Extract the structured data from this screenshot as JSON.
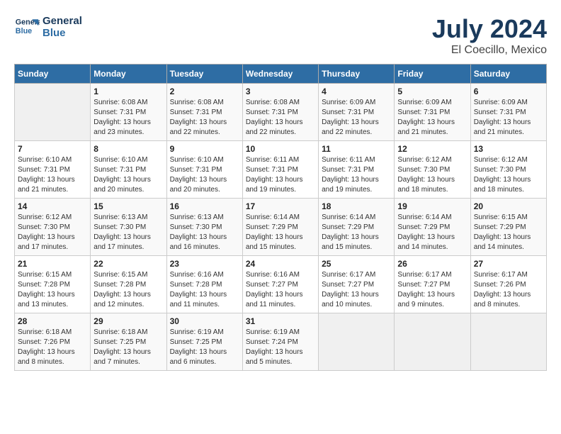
{
  "header": {
    "logo_line1": "General",
    "logo_line2": "Blue",
    "month_year": "July 2024",
    "location": "El Coecillo, Mexico"
  },
  "days_of_week": [
    "Sunday",
    "Monday",
    "Tuesday",
    "Wednesday",
    "Thursday",
    "Friday",
    "Saturday"
  ],
  "weeks": [
    [
      {
        "day": "",
        "info": ""
      },
      {
        "day": "1",
        "info": "Sunrise: 6:08 AM\nSunset: 7:31 PM\nDaylight: 13 hours\nand 23 minutes."
      },
      {
        "day": "2",
        "info": "Sunrise: 6:08 AM\nSunset: 7:31 PM\nDaylight: 13 hours\nand 22 minutes."
      },
      {
        "day": "3",
        "info": "Sunrise: 6:08 AM\nSunset: 7:31 PM\nDaylight: 13 hours\nand 22 minutes."
      },
      {
        "day": "4",
        "info": "Sunrise: 6:09 AM\nSunset: 7:31 PM\nDaylight: 13 hours\nand 22 minutes."
      },
      {
        "day": "5",
        "info": "Sunrise: 6:09 AM\nSunset: 7:31 PM\nDaylight: 13 hours\nand 21 minutes."
      },
      {
        "day": "6",
        "info": "Sunrise: 6:09 AM\nSunset: 7:31 PM\nDaylight: 13 hours\nand 21 minutes."
      }
    ],
    [
      {
        "day": "7",
        "info": ""
      },
      {
        "day": "8",
        "info": "Sunrise: 6:10 AM\nSunset: 7:31 PM\nDaylight: 13 hours\nand 20 minutes."
      },
      {
        "day": "9",
        "info": "Sunrise: 6:10 AM\nSunset: 7:31 PM\nDaylight: 13 hours\nand 20 minutes."
      },
      {
        "day": "10",
        "info": "Sunrise: 6:11 AM\nSunset: 7:31 PM\nDaylight: 13 hours\nand 19 minutes."
      },
      {
        "day": "11",
        "info": "Sunrise: 6:11 AM\nSunset: 7:31 PM\nDaylight: 13 hours\nand 19 minutes."
      },
      {
        "day": "12",
        "info": "Sunrise: 6:12 AM\nSunset: 7:30 PM\nDaylight: 13 hours\nand 18 minutes."
      },
      {
        "day": "13",
        "info": "Sunrise: 6:12 AM\nSunset: 7:30 PM\nDaylight: 13 hours\nand 18 minutes."
      }
    ],
    [
      {
        "day": "14",
        "info": ""
      },
      {
        "day": "15",
        "info": "Sunrise: 6:13 AM\nSunset: 7:30 PM\nDaylight: 13 hours\nand 17 minutes."
      },
      {
        "day": "16",
        "info": "Sunrise: 6:13 AM\nSunset: 7:30 PM\nDaylight: 13 hours\nand 16 minutes."
      },
      {
        "day": "17",
        "info": "Sunrise: 6:14 AM\nSunset: 7:29 PM\nDaylight: 13 hours\nand 15 minutes."
      },
      {
        "day": "18",
        "info": "Sunrise: 6:14 AM\nSunset: 7:29 PM\nDaylight: 13 hours\nand 15 minutes."
      },
      {
        "day": "19",
        "info": "Sunrise: 6:14 AM\nSunset: 7:29 PM\nDaylight: 13 hours\nand 14 minutes."
      },
      {
        "day": "20",
        "info": "Sunrise: 6:15 AM\nSunset: 7:29 PM\nDaylight: 13 hours\nand 14 minutes."
      }
    ],
    [
      {
        "day": "21",
        "info": ""
      },
      {
        "day": "22",
        "info": "Sunrise: 6:15 AM\nSunset: 7:28 PM\nDaylight: 13 hours\nand 12 minutes."
      },
      {
        "day": "23",
        "info": "Sunrise: 6:16 AM\nSunset: 7:28 PM\nDaylight: 13 hours\nand 11 minutes."
      },
      {
        "day": "24",
        "info": "Sunrise: 6:16 AM\nSunset: 7:27 PM\nDaylight: 13 hours\nand 11 minutes."
      },
      {
        "day": "25",
        "info": "Sunrise: 6:17 AM\nSunset: 7:27 PM\nDaylight: 13 hours\nand 10 minutes."
      },
      {
        "day": "26",
        "info": "Sunrise: 6:17 AM\nSunset: 7:27 PM\nDaylight: 13 hours\nand 9 minutes."
      },
      {
        "day": "27",
        "info": "Sunrise: 6:17 AM\nSunset: 7:26 PM\nDaylight: 13 hours\nand 8 minutes."
      }
    ],
    [
      {
        "day": "28",
        "info": "Sunrise: 6:18 AM\nSunset: 7:26 PM\nDaylight: 13 hours\nand 8 minutes."
      },
      {
        "day": "29",
        "info": "Sunrise: 6:18 AM\nSunset: 7:25 PM\nDaylight: 13 hours\nand 7 minutes."
      },
      {
        "day": "30",
        "info": "Sunrise: 6:19 AM\nSunset: 7:25 PM\nDaylight: 13 hours\nand 6 minutes."
      },
      {
        "day": "31",
        "info": "Sunrise: 6:19 AM\nSunset: 7:24 PM\nDaylight: 13 hours\nand 5 minutes."
      },
      {
        "day": "",
        "info": ""
      },
      {
        "day": "",
        "info": ""
      },
      {
        "day": "",
        "info": ""
      }
    ]
  ],
  "week1_day7_info": "Sunrise: 6:10 AM\nSunset: 7:31 PM\nDaylight: 13 hours\nand 21 minutes.",
  "week2_day14_info": "Sunrise: 6:12 AM\nSunset: 7:30 PM\nDaylight: 13 hours\nand 17 minutes.",
  "week3_day21_info": "Sunrise: 6:15 AM\nSunset: 7:28 PM\nDaylight: 13 hours\nand 13 minutes."
}
